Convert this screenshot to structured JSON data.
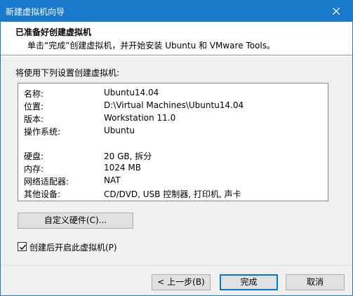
{
  "window": {
    "title": "新建虚拟机向导"
  },
  "header": {
    "heading": "已准备好创建虚拟机",
    "subheading": "单击“完成”创建虚拟机，并开始安装 Ubuntu 和 VMware Tools。"
  },
  "intro": "将使用下列设置创建虚拟机:",
  "settings": [
    {
      "label": "名称:",
      "value": "Ubuntu14.04"
    },
    {
      "label": "位置:",
      "value": "D:\\Virtual Machines\\Ubuntu14.04"
    },
    {
      "label": "版本:",
      "value": "Workstation 11.0"
    },
    {
      "label": "操作系统:",
      "value": "Ubuntu"
    },
    {
      "label": "硬盘:",
      "value": "20 GB, 拆分"
    },
    {
      "label": "内存:",
      "value": "1024 MB"
    },
    {
      "label": "网络适配器:",
      "value": "NAT"
    },
    {
      "label": "其他设备:",
      "value": "CD/DVD, USB 控制器, 打印机, 声卡"
    }
  ],
  "buttons": {
    "customize": "自定义硬件(C)...",
    "back": "< 上一步(B)",
    "finish": "完成",
    "cancel": "取消"
  },
  "checkbox": {
    "label": "创建后开启此虚拟机(P)",
    "checked": true
  }
}
